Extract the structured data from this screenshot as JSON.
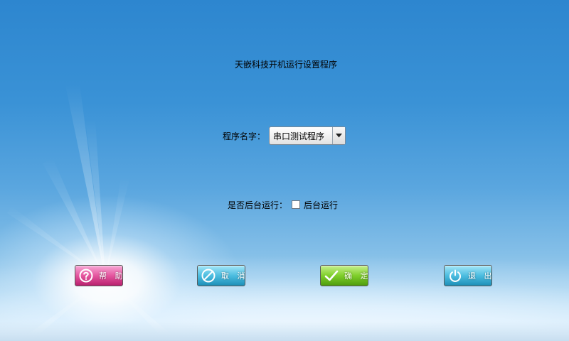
{
  "window": {
    "title": "天嵌科技开机运行设置程序"
  },
  "program_name": {
    "label": "程序名字：",
    "selected": "串口测试程序"
  },
  "background_run": {
    "label": "是否后台运行：",
    "checkbox_label": "后台运行",
    "checked": false
  },
  "buttons": {
    "help": "帮 助",
    "cancel": "取 消",
    "ok": "确 定",
    "exit": "退 出"
  },
  "icons": {
    "help": "question-icon",
    "cancel": "no-entry-icon",
    "ok": "check-icon",
    "exit": "power-icon",
    "dropdown": "dropdown-arrow-icon"
  }
}
